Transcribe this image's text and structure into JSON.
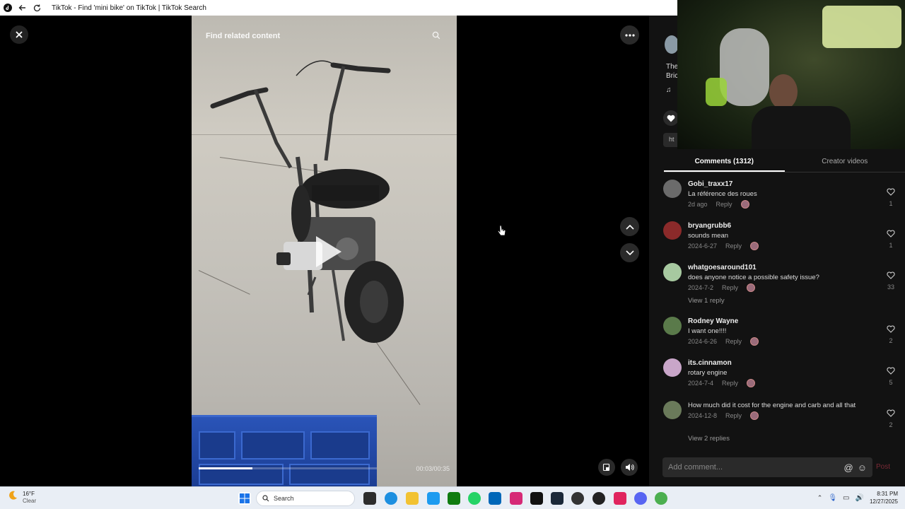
{
  "window": {
    "tab_title": "TikTok - Find 'mini bike' on TikTok | TikTok Search"
  },
  "video": {
    "search_placeholder": "Find related content",
    "time": "00:03/00:35",
    "progress": 0.3
  },
  "panel": {
    "partial_desc_line1": "The",
    "partial_desc_line2": "Bric",
    "partial_link": "ht",
    "tabs": [
      {
        "label": "Comments (1312)",
        "active": true
      },
      {
        "label": "Creator videos",
        "active": false
      }
    ],
    "comment_placeholder": "Add comment...",
    "post_label": "Post"
  },
  "comments": [
    {
      "user": "Gobi_traxx17",
      "text": "La référence des roues",
      "date": "2d ago",
      "reply": "Reply",
      "likes": "1",
      "avatar_color": "#6b6b6b"
    },
    {
      "user": "bryangrubb6",
      "text": "sounds mean",
      "date": "2024-6-27",
      "reply": "Reply",
      "likes": "1",
      "avatar_color": "#8b2a2a"
    },
    {
      "user": "whatgoesaround101",
      "text": "does anyone notice a possible safety issue?",
      "date": "2024-7-2",
      "reply": "Reply",
      "likes": "33",
      "avatar_color": "#a7c9a0",
      "view_replies": "View 1 reply"
    },
    {
      "user": "Rodney Wayne",
      "text": "I want one!!!!",
      "date": "2024-6-26",
      "reply": "Reply",
      "likes": "2",
      "avatar_color": "#5a7a4a"
    },
    {
      "user": "its.cinnamon",
      "text": "rotary engine",
      "date": "2024-7-4",
      "reply": "Reply",
      "likes": "5",
      "avatar_color": "#c9a6c9"
    },
    {
      "user": "",
      "text": "How much did it cost for the engine and carb and all that",
      "date": "2024-12-8",
      "reply": "Reply",
      "likes": "2",
      "avatar_color": "#6a7a5a",
      "view_replies": "View 2 replies"
    }
  ],
  "taskbar": {
    "weather_temp": "16°F",
    "weather_desc": "Clear",
    "search_label": "Search",
    "time": "8:31 PM",
    "date": "12/27/2025"
  }
}
